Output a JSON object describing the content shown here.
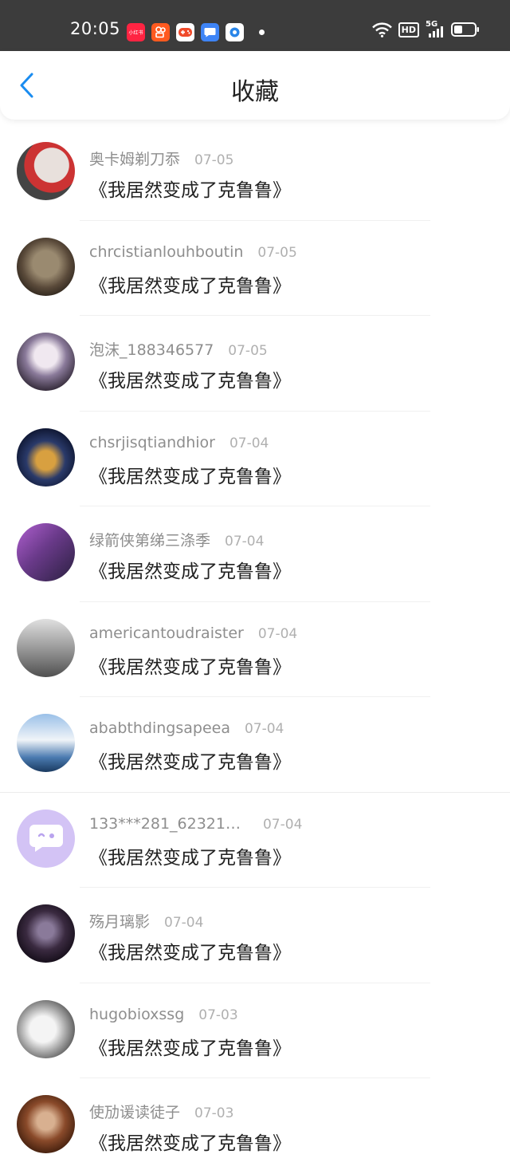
{
  "status_bar": {
    "time": "20:05",
    "app_icons": [
      {
        "name": "xiaohongshu-icon",
        "color": "#ff2442",
        "text": "小红书"
      },
      {
        "name": "kuaishou-icon",
        "color": "#ff5a1f"
      },
      {
        "name": "game-center-icon",
        "color": "#ffffff"
      },
      {
        "name": "message-icon",
        "color": "#3e84f6"
      },
      {
        "name": "camera-app-icon",
        "color": "#ffffff"
      }
    ],
    "hd_label": "HD",
    "network_label": "5G"
  },
  "header": {
    "title": "收藏"
  },
  "items": [
    {
      "name": "奥卡姆剃刀忝",
      "date": "07-05",
      "book": "《我居然变成了克鲁鲁》",
      "avatar_color": "#c33"
    },
    {
      "name": "chrcistianlouhboutin",
      "date": "07-05",
      "book": "《我居然变成了克鲁鲁》",
      "avatar_color": "#5a4a3a"
    },
    {
      "name": "泡沫_188346577",
      "date": "07-05",
      "book": "《我居然变成了克鲁鲁》",
      "avatar_color": "#8a7a9a"
    },
    {
      "name": "chsrjisqtiandhior",
      "date": "07-04",
      "book": "《我居然变成了克鲁鲁》",
      "avatar_color": "#2a3a6a"
    },
    {
      "name": "绿箭侠第绨三涤季",
      "date": "07-04",
      "book": "《我居然变成了克鲁鲁》",
      "avatar_color": "#6a3a8a"
    },
    {
      "name": "americantoudraister",
      "date": "07-04",
      "book": "《我居然变成了克鲁鲁》",
      "avatar_color": "#8a8a8a"
    },
    {
      "name": "ababthdingsapeea",
      "date": "07-04",
      "book": "《我居然变成了克鲁鲁》",
      "avatar_color": "#4a7ab0"
    },
    {
      "name": "133***281_62321…",
      "date": "07-04",
      "book": "《我居然变成了克鲁鲁》",
      "avatar_color": "#c9b8f0"
    },
    {
      "name": "殇月璃影",
      "date": "07-04",
      "book": "《我居然变成了克鲁鲁》",
      "avatar_color": "#2a2030"
    },
    {
      "name": "hugobioxssg",
      "date": "07-03",
      "book": "《我居然变成了克鲁鲁》",
      "avatar_color": "#707070"
    },
    {
      "name": "使劢谖读徒子",
      "date": "07-03",
      "book": "《我居然变成了克鲁鲁》",
      "avatar_color": "#8a4a2a"
    }
  ]
}
